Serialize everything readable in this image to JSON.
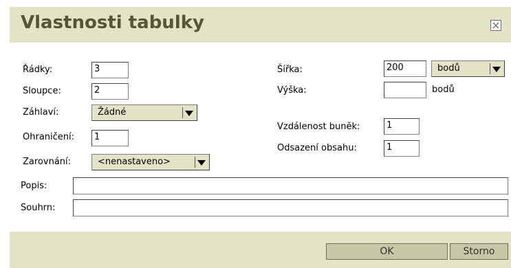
{
  "dialog": {
    "title": "Vlastnosti tabulky",
    "close_icon": "close-icon"
  },
  "left": {
    "rows_label": "Řádky:",
    "rows_value": "3",
    "cols_label": "Sloupce:",
    "cols_value": "2",
    "header_label": "Záhlaví:",
    "header_value": "Žádné",
    "border_label": "Ohraničení:",
    "border_value": "1",
    "align_label": "Zarovnání:",
    "align_value": "<nenastaveno>"
  },
  "right": {
    "width_label": "Šířka:",
    "width_value": "200",
    "width_unit": "bodů",
    "height_label": "Výška:",
    "height_value": "",
    "height_unit": "bodů",
    "spacing_label": "Vzdálenost buněk:",
    "spacing_value": "1",
    "padding_label": "Odsazení obsahu:",
    "padding_value": "1"
  },
  "caption_label": "Popis:",
  "caption_value": "",
  "summary_label": "Souhrn:",
  "summary_value": "",
  "buttons": {
    "ok": "OK",
    "cancel": "Storno"
  },
  "colors": {
    "bar_bg": "#e3e3c7",
    "title_text": "#55553a",
    "button_bg": "#c7c7a5"
  }
}
